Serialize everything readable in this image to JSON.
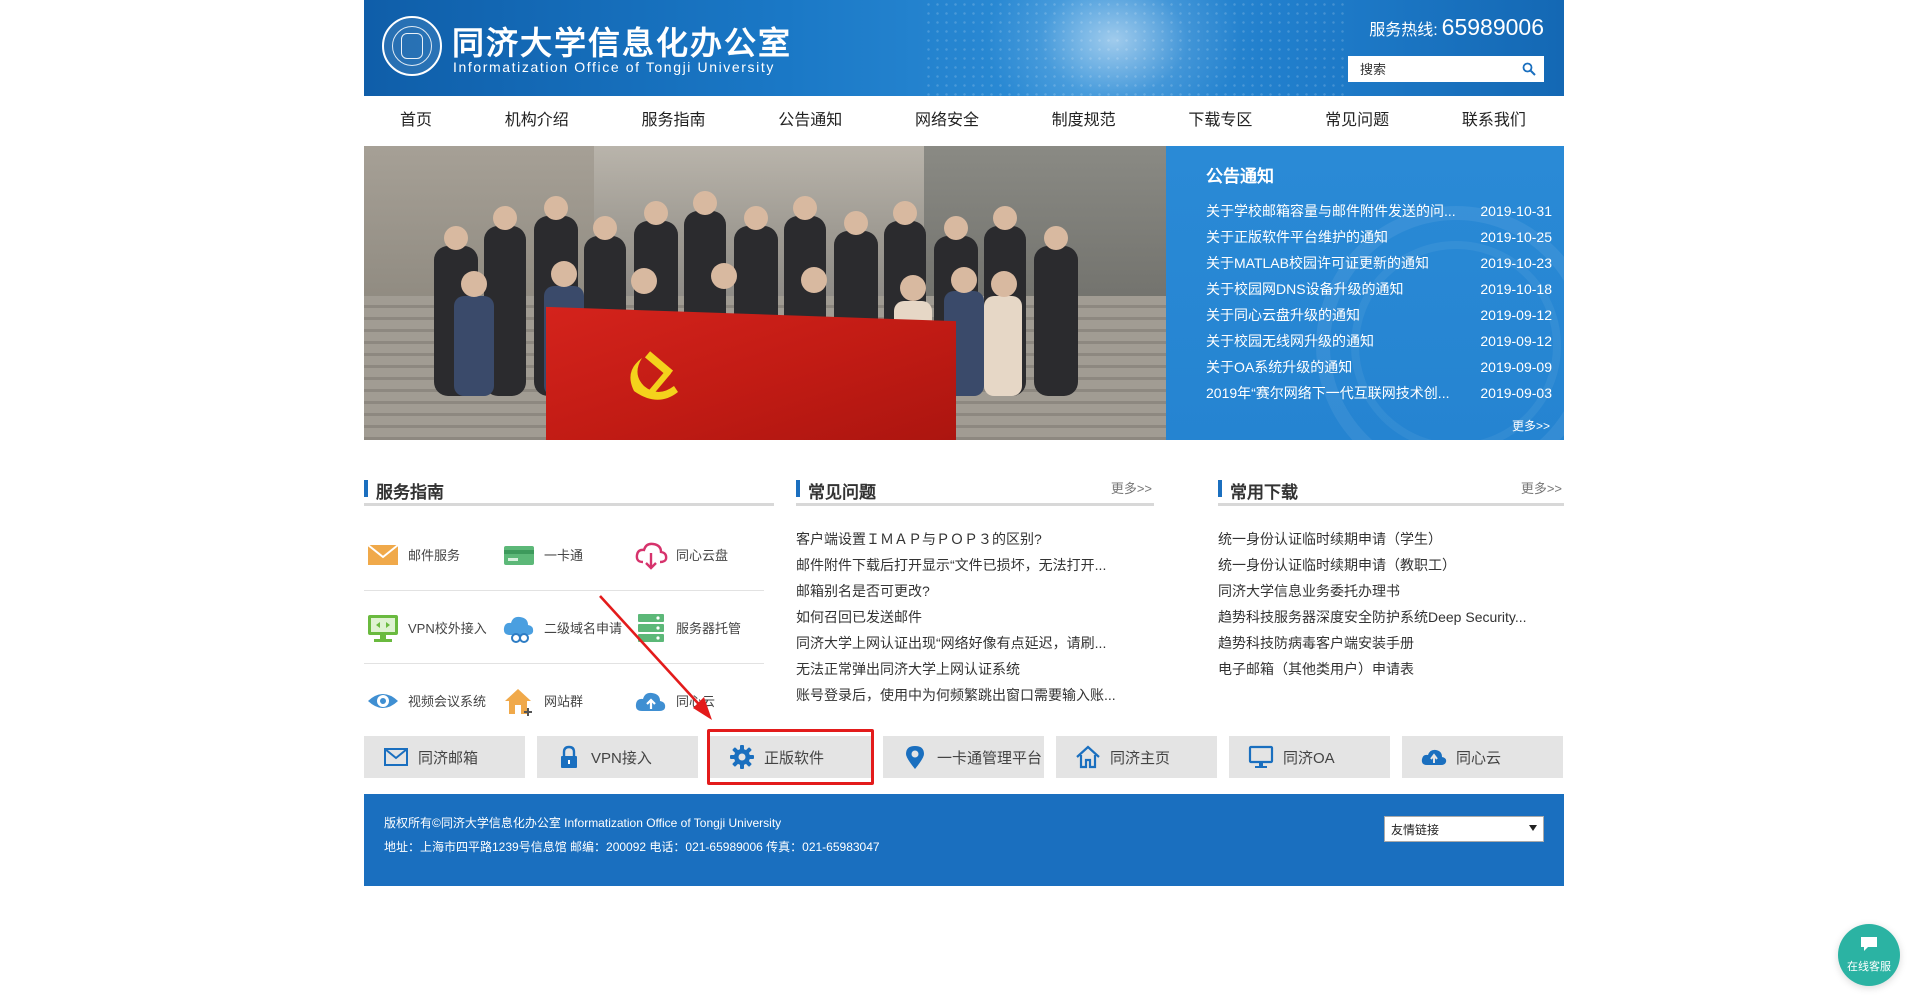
{
  "header": {
    "title": "同济大学信息化办公室",
    "subtitle": "Informatization Office of Tongji University",
    "hotline_label": "服务热线:",
    "hotline_number": "65989006",
    "search_placeholder": "搜索"
  },
  "nav": {
    "items": [
      "首页",
      "机构介绍",
      "服务指南",
      "公告通知",
      "网络安全",
      "制度规范",
      "下载专区",
      "常见问题",
      "联系我们"
    ]
  },
  "notice": {
    "title": "公告通知",
    "items": [
      {
        "title": "关于学校邮箱容量与邮件附件发送的问...",
        "date": "2019-10-31"
      },
      {
        "title": "关于正版软件平台维护的通知",
        "date": "2019-10-25"
      },
      {
        "title": "关于MATLAB校园许可证更新的通知",
        "date": "2019-10-23"
      },
      {
        "title": "关于校园网DNS设备升级的通知",
        "date": "2019-10-18"
      },
      {
        "title": "关于同心云盘升级的通知",
        "date": "2019-09-12"
      },
      {
        "title": "关于校园无线网升级的通知",
        "date": "2019-09-12"
      },
      {
        "title": "关于OA系统升级的通知",
        "date": "2019-09-09"
      },
      {
        "title": "2019年“赛尔网络下一代互联网技术创...",
        "date": "2019-09-03"
      }
    ],
    "more": "更多>>"
  },
  "services": {
    "title": "服务指南",
    "items": [
      "邮件服务",
      "一卡通",
      "同心云盘",
      "VPN校外接入",
      "二级域名申请",
      "服务器托管",
      "视频会议系统",
      "网站群",
      "同心云"
    ]
  },
  "faq": {
    "title": "常见问题",
    "more": "更多>>",
    "items": [
      "客户端设置ＩＭＡＰ与ＰＯＰ３的区别?",
      "邮件附件下载后打开显示“文件已损坏，无法打开...",
      "邮箱别名是否可更改?",
      "如何召回已发送邮件",
      "同济大学上网认证出现“网络好像有点延迟，请刷...",
      "无法正常弹出同济大学上网认证系统",
      "账号登录后，使用中为何频繁跳出窗口需要输入账..."
    ]
  },
  "downloads": {
    "title": "常用下载",
    "more": "更多>>",
    "items": [
      "统一身份认证临时续期申请（学生）",
      "统一身份认证临时续期申请（教职工）",
      "同济大学信息业务委托办理书",
      "趋势科技服务器深度安全防护系统Deep Security...",
      "趋势科技防病毒客户端安装手册",
      "电子邮箱（其他类用户）申请表"
    ]
  },
  "quick_links": [
    "同济邮箱",
    "VPN接入",
    "正版软件",
    "一卡通管理平台",
    "同济主页",
    "同济OA",
    "同心云"
  ],
  "footer": {
    "line1": "版权所有©同济大学信息化办公室 Informatization Office of Tongji University",
    "line2": "地址：上海市四平路1239号信息馆 邮编：200092 电话：021-65989006 传真：021-65983047",
    "friend_links": "友情链接"
  },
  "chat": {
    "label": "在线客服"
  },
  "colors": {
    "brand_blue": "#1a6fbf",
    "notice_blue": "#2584d1",
    "highlight_red": "#e31b1b",
    "chat_teal": "#2bb3a3"
  },
  "icons": {
    "search": "search-icon",
    "mail": "mail-icon",
    "card": "card-icon",
    "cloud_download": "cloud-download-icon",
    "vpn": "vpn-monitor-icon",
    "cloud_link": "cloud-link-icon",
    "server": "server-icon",
    "eye": "eye-icon",
    "house": "house-plus-icon",
    "cloud_upload": "cloud-upload-icon",
    "lock": "lock-icon",
    "gear": "gear-icon",
    "location": "location-pin-icon",
    "home": "home-icon",
    "monitor": "monitor-icon",
    "chat": "chat-bubble-icon"
  }
}
